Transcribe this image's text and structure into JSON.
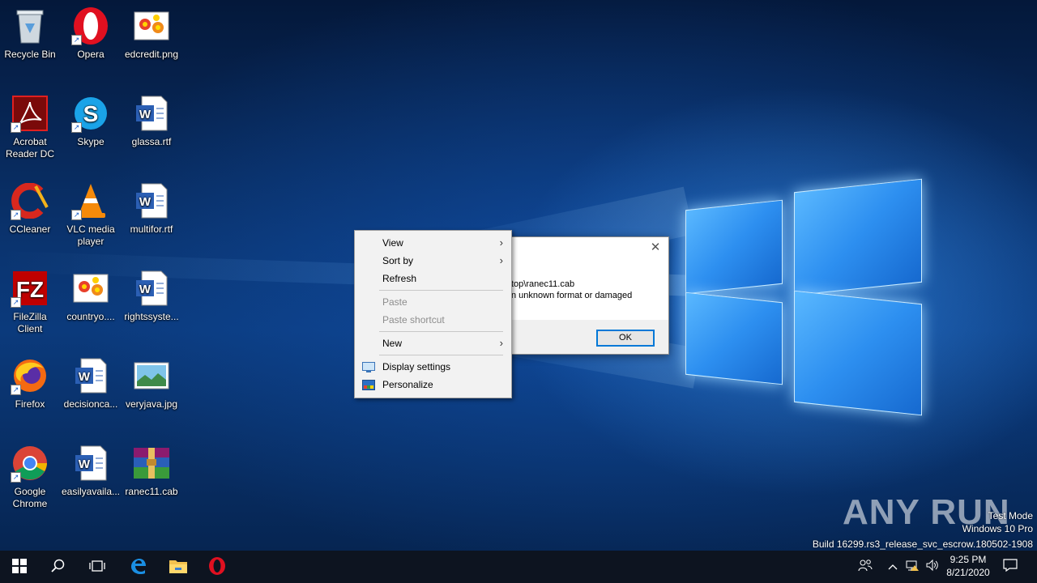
{
  "desktop_icons": [
    {
      "label": "Recycle Bin",
      "icon": "recycle-bin-icon"
    },
    {
      "label": "Opera",
      "icon": "opera-icon"
    },
    {
      "label": "edcredit.png",
      "icon": "image-file-icon"
    },
    {
      "label": "Acrobat Reader DC",
      "icon": "acrobat-icon"
    },
    {
      "label": "Skype",
      "icon": "skype-icon"
    },
    {
      "label": "glassa.rtf",
      "icon": "word-document-icon"
    },
    {
      "label": "CCleaner",
      "icon": "ccleaner-icon"
    },
    {
      "label": "VLC media player",
      "icon": "vlc-icon"
    },
    {
      "label": "multifor.rtf",
      "icon": "word-document-icon"
    },
    {
      "label": "FileZilla Client",
      "icon": "filezilla-icon"
    },
    {
      "label": "countryo....",
      "icon": "image-file-icon"
    },
    {
      "label": "rightssyste...",
      "icon": "word-document-icon"
    },
    {
      "label": "Firefox",
      "icon": "firefox-icon"
    },
    {
      "label": "decisionca...",
      "icon": "word-document-icon"
    },
    {
      "label": "veryjava.jpg",
      "icon": "landscape-image-icon"
    },
    {
      "label": "Google Chrome",
      "icon": "chrome-icon"
    },
    {
      "label": "easilyavaila...",
      "icon": "word-document-icon"
    },
    {
      "label": "ranec11.cab",
      "icon": "winrar-archive-icon"
    }
  ],
  "dialog": {
    "message_line1": "top\\ranec11.cab",
    "message_line2": "n unknown format or damaged",
    "ok_label": "OK",
    "close_glyph": "✕"
  },
  "context_menu": {
    "view": "View",
    "sort_by": "Sort by",
    "refresh": "Refresh",
    "paste": "Paste",
    "paste_shortcut": "Paste shortcut",
    "new": "New",
    "display_settings": "Display settings",
    "personalize": "Personalize",
    "submenu_arrow": "›"
  },
  "taskbar": {
    "time": "9:25 PM",
    "date": "8/21/2020"
  },
  "watermark": {
    "line1": "Test Mode",
    "line2": "Windows 10 Pro",
    "line3": "Build 16299.rs3_release_svc_escrow.180502-1908",
    "brand": "ANY RUN"
  },
  "colors": {
    "accent": "#0078d7",
    "taskbar": "#0d1420",
    "menu_bg": "#f2f2f2"
  }
}
